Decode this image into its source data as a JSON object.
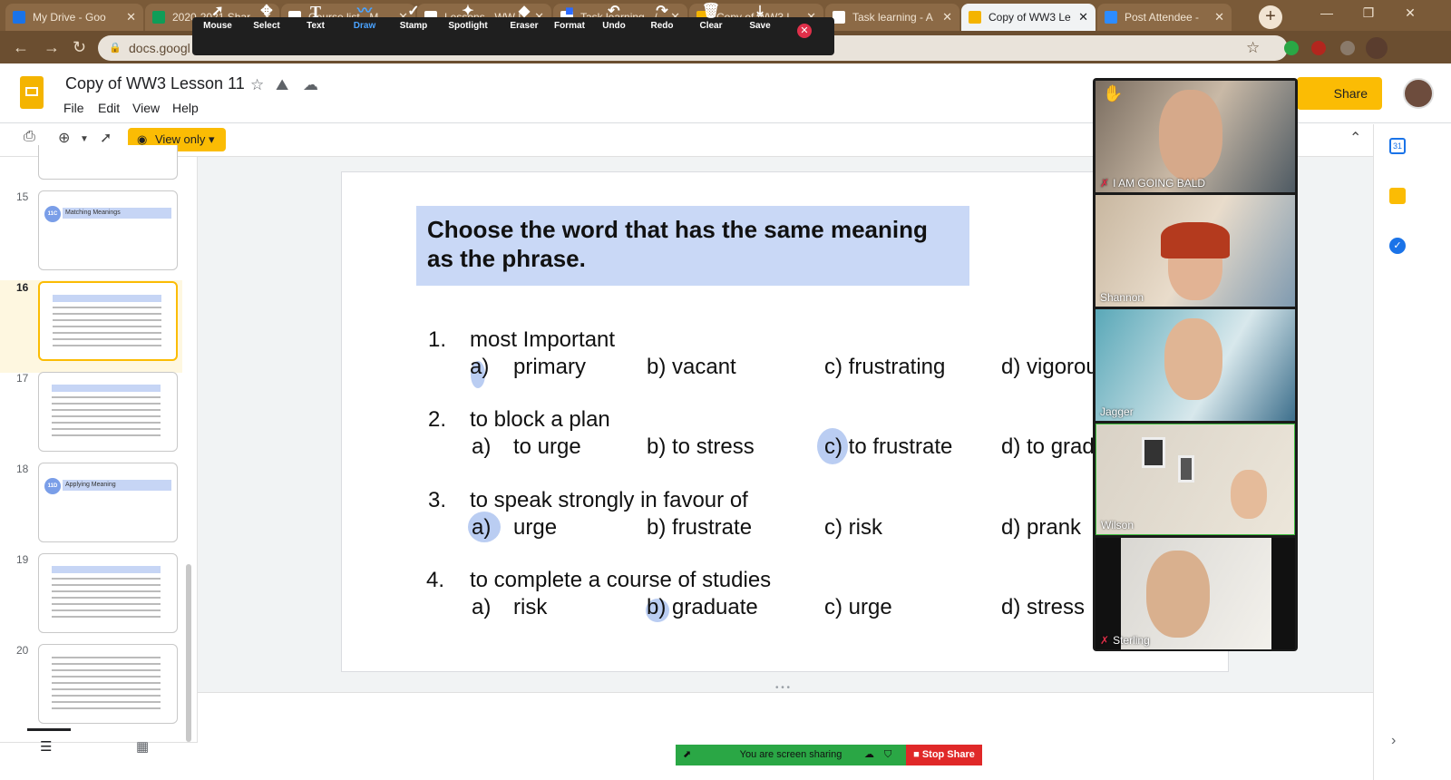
{
  "browser": {
    "tabs": [
      {
        "label": "My Drive - Goo",
        "color": "#1a73e8"
      },
      {
        "label": "2020-2021 Shar",
        "color": "#0f9d58"
      },
      {
        "label": "Course list - M",
        "color": "#ffffff"
      },
      {
        "label": "Lessons - WW L",
        "color": "#ffffff"
      },
      {
        "label": "Task learning - /",
        "color": "#ffffff"
      },
      {
        "label": "Copy of WW3 L",
        "color": "#f4b400"
      },
      {
        "label": "Task learning - A",
        "color": "#ffffff"
      },
      {
        "label": "Copy of WW3 Le",
        "color": "#f4b400"
      },
      {
        "label": "Post Attendee -",
        "color": "#2d8cff"
      }
    ],
    "url": "docs.googl"
  },
  "zoom_toolbar": {
    "tools": [
      {
        "label": "Mouse",
        "icon": "➚"
      },
      {
        "label": "Select",
        "icon": "✥"
      },
      {
        "label": "Text",
        "icon": "T"
      },
      {
        "label": "Draw",
        "icon": "〰"
      },
      {
        "label": "Stamp",
        "icon": "✓"
      },
      {
        "label": "Spotlight",
        "icon": "✦"
      },
      {
        "label": "Eraser",
        "icon": "◆"
      },
      {
        "label": "Format",
        "icon": "■"
      },
      {
        "label": "Undo",
        "icon": "↶"
      },
      {
        "label": "Redo",
        "icon": "↷"
      },
      {
        "label": "Clear",
        "icon": "🗑"
      },
      {
        "label": "Save",
        "icon": "⤓"
      }
    ]
  },
  "doc": {
    "title": "Copy of WW3 Lesson 11",
    "menu": [
      "File",
      "Edit",
      "View",
      "Help"
    ],
    "share_label": "Share",
    "view_only_label": "View only"
  },
  "filmstrip": {
    "slides": [
      {
        "num": "15",
        "badge": "11C",
        "heading": "Matching Meanings"
      },
      {
        "num": "16"
      },
      {
        "num": "17"
      },
      {
        "num": "18",
        "badge": "11D",
        "heading": "Applying Meaning"
      },
      {
        "num": "19"
      },
      {
        "num": "20"
      }
    ]
  },
  "slide": {
    "heading": "Choose the word that has the same meaning as the phrase.",
    "questions": [
      {
        "num": "1.",
        "text": "most Important",
        "options": [
          "a)",
          "primary",
          "b) vacant",
          "c) frustrating",
          "d) vigorou"
        ]
      },
      {
        "num": "2.",
        "text": "to block a plan",
        "options": [
          "a)",
          "to urge",
          "b) to stress",
          "c) to frustrate",
          "d) to grad"
        ]
      },
      {
        "num": "3.",
        "text": "to speak strongly in favour of",
        "options": [
          "a)",
          "urge",
          "b) frustrate",
          "c) risk",
          "d) prank"
        ]
      },
      {
        "num": "4.",
        "text": "to complete a course of studies",
        "options": [
          "a)",
          "risk",
          "b) graduate",
          "c) urge",
          "d) stress"
        ]
      }
    ]
  },
  "zoom_gallery": {
    "participants": [
      {
        "name": "I AM GOING BALD",
        "muted": true
      },
      {
        "name": "Shannon",
        "muted": false
      },
      {
        "name": "Jagger",
        "muted": false
      },
      {
        "name": "Wilson",
        "muted": false
      },
      {
        "name": "Sterling",
        "muted": true
      }
    ]
  },
  "screen_share": {
    "status": "You are screen sharing",
    "stop_label": "Stop Share"
  }
}
